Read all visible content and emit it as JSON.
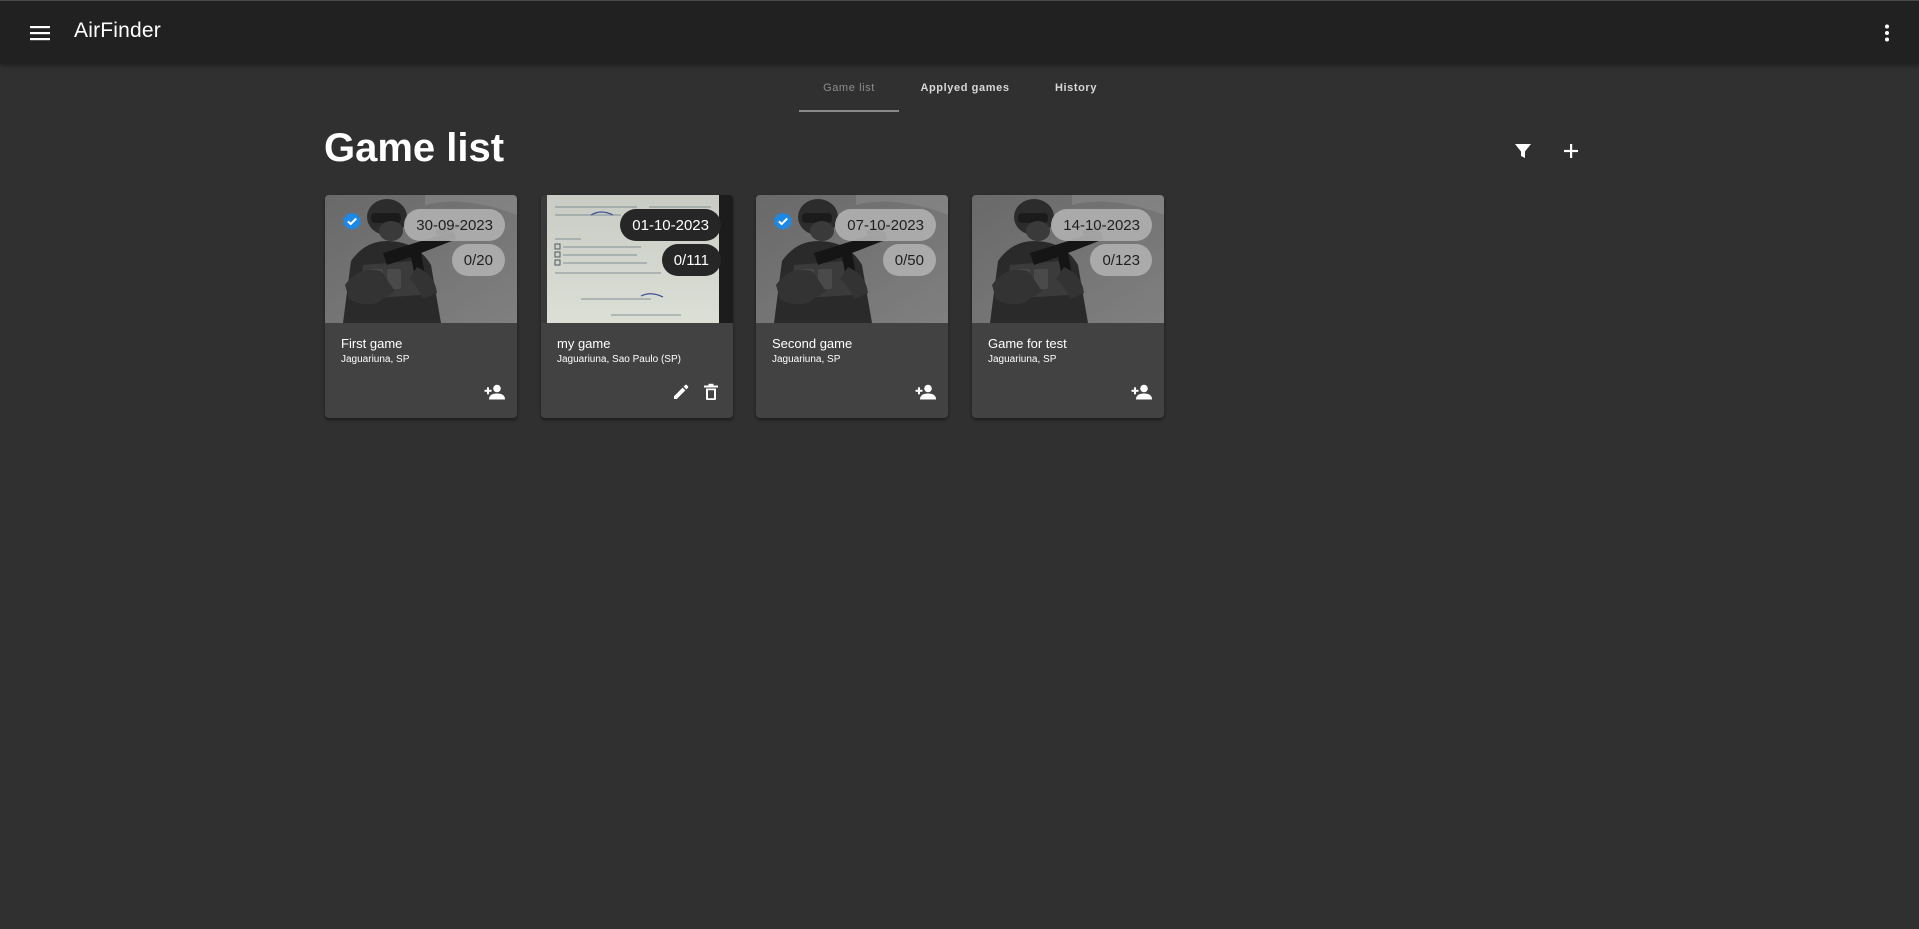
{
  "app": {
    "title": "AirFinder"
  },
  "topbar": {
    "menu_icon": "menu-icon",
    "more_icon": "more-vert-icon"
  },
  "tabs": [
    {
      "label": "Game list",
      "active": true
    },
    {
      "label": "Applyed games",
      "active": false
    },
    {
      "label": "History",
      "active": false
    }
  ],
  "page": {
    "title": "Game list",
    "filter_icon": "filter-icon",
    "add_icon": "add-icon"
  },
  "colors": {
    "background": "#303030",
    "toolbar": "#212121",
    "card": "#424242",
    "verified": "#1e88e5"
  },
  "cards": [
    {
      "title": "First game",
      "location": "Jaguariuna, SP",
      "date": "30-09-2023",
      "players": "0/20",
      "verified": true,
      "image": "soldier-photo",
      "actions": [
        "person-add-icon"
      ]
    },
    {
      "title": "my game",
      "location": "Jaguariuna, Sao Paulo (SP)",
      "date": "01-10-2023",
      "players": "0/111",
      "verified": false,
      "image": "document-photo",
      "actions": [
        "edit-icon",
        "delete-icon"
      ]
    },
    {
      "title": "Second game",
      "location": "Jaguariuna, SP",
      "date": "07-10-2023",
      "players": "0/50",
      "verified": true,
      "image": "soldier-photo",
      "actions": [
        "person-add-icon"
      ]
    },
    {
      "title": "Game for test",
      "location": "Jaguariuna, SP",
      "date": "14-10-2023",
      "players": "0/123",
      "verified": false,
      "image": "soldier-photo",
      "actions": [
        "person-add-icon"
      ]
    }
  ]
}
